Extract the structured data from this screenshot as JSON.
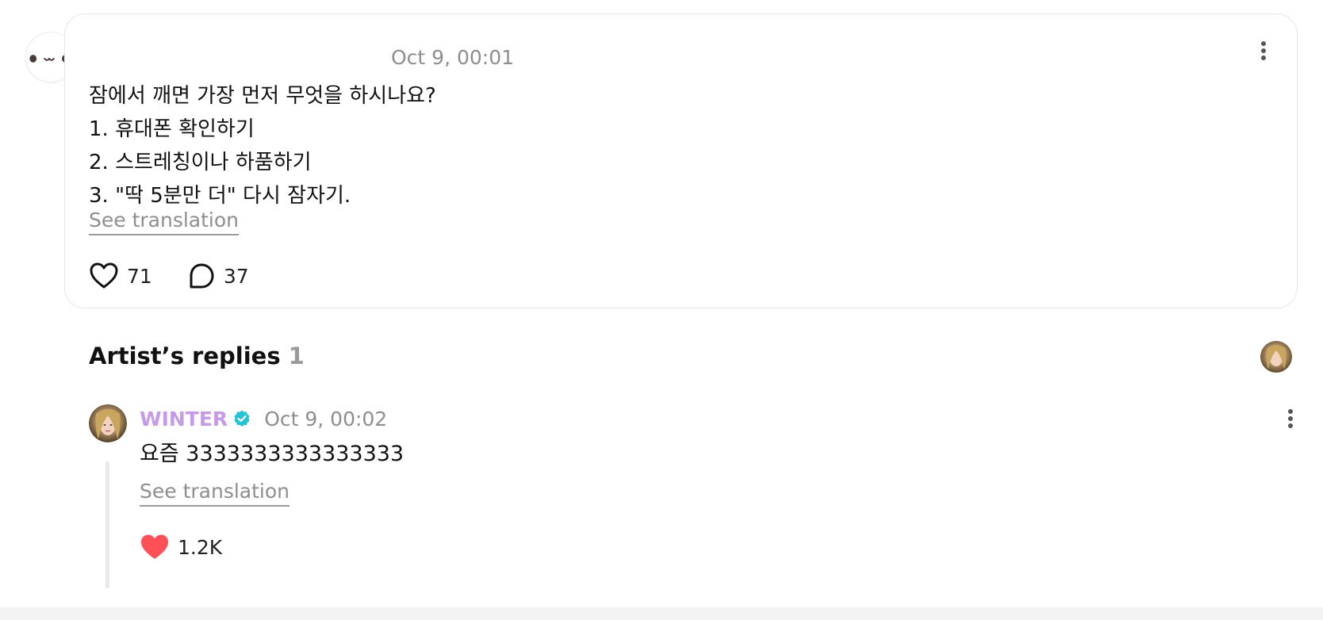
{
  "colors": {
    "author_name": "#c69ae6",
    "verified_badge": "#27c2d6",
    "liked_heart": "#ff4f57",
    "meta_text": "#8e8e8e"
  },
  "post": {
    "timestamp": "Oct 9, 00:01",
    "lines": [
      "잠에서 깨면 가장 먼저 무엇을 하시나요?",
      "1. 휴대폰 확인하기",
      "2. 스트레칭이나 하품하기",
      "3. \"딱 5분만 더\" 다시 잠자기."
    ],
    "translate_label": "See translation",
    "like_count": "71",
    "comment_count": "37",
    "icons": {
      "like": "heart-outline-icon",
      "comment": "speech-bubble-icon",
      "more": "more-vertical-icon"
    }
  },
  "artist_replies": {
    "title": "Artist’s replies",
    "count": "1",
    "reply": {
      "author": "WINTER",
      "timestamp": "Oct 9, 00:02",
      "text": "요즘 3333333333333333",
      "translate_label": "See translation",
      "like_count": "1.2K",
      "icons": {
        "like": "heart-filled-icon",
        "verified": "verified-badge-icon",
        "more": "more-vertical-icon"
      }
    }
  }
}
